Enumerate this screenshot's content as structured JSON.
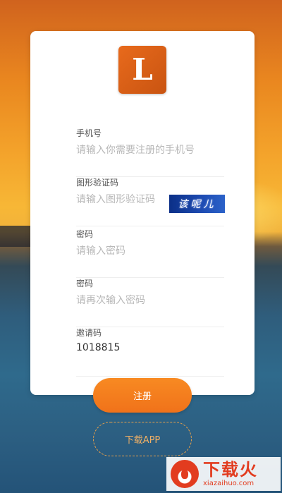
{
  "logo": {
    "letter": "L"
  },
  "form": {
    "phone": {
      "label": "手机号",
      "placeholder": "请输入你需要注册的手机号"
    },
    "captcha": {
      "label": "图形验证码",
      "placeholder": "请输入图形验证码",
      "image_text": "该呢儿"
    },
    "password": {
      "label": "密码",
      "placeholder": "请输入密码"
    },
    "password_confirm": {
      "label": "密码",
      "placeholder": "请再次输入密码"
    },
    "invite": {
      "label": "邀请码",
      "value": "1018815"
    }
  },
  "buttons": {
    "register": "注册",
    "download": "下载APP"
  },
  "watermark": {
    "title": "下载火",
    "url": "xiazaihuo.com"
  },
  "colors": {
    "accent": "#f57e20",
    "card": "#ffffff",
    "captcha_bg": "#1a44a8"
  }
}
